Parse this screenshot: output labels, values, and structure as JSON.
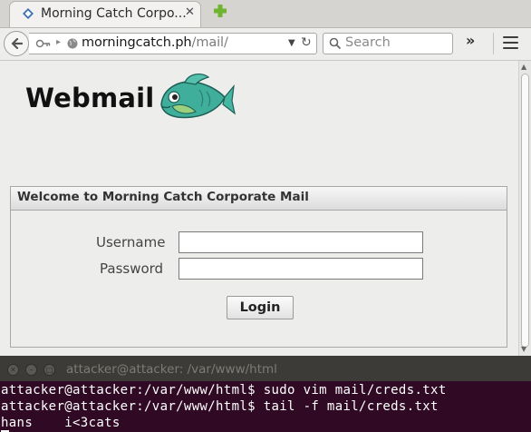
{
  "browser": {
    "tab": {
      "title": "Morning Catch Corpo...",
      "close": "✕"
    },
    "address": {
      "host": "morningcatch.ph",
      "path": "/mail/"
    },
    "search": {
      "placeholder": "Search"
    },
    "overflow": "»"
  },
  "page": {
    "logo_text": "Webmail",
    "login": {
      "title": "Welcome to Morning Catch Corporate Mail",
      "username_label": "Username",
      "password_label": "Password",
      "username_value": "",
      "password_value": "",
      "button_label": "Login"
    }
  },
  "terminal": {
    "title": "attacker@attacker: /var/www/html",
    "lines": [
      "attacker@attacker:/var/www/html$ sudo vim mail/creds.txt",
      "attacker@attacker:/var/www/html$ tail -f mail/creds.txt",
      "hans    i<3cats"
    ]
  },
  "colors": {
    "terminal_bg": "#300a24",
    "window_chrome": "#3c3b37",
    "tab_new_plus": "#6fb330"
  },
  "icons": [
    "webmail-favicon",
    "new-tab-plus-icon",
    "back-arrow-icon",
    "key-icon",
    "globe-icon",
    "dropdown-icon",
    "reload-icon",
    "search-icon",
    "overflow-icon",
    "hamburger-menu-icon",
    "fish-logo"
  ]
}
